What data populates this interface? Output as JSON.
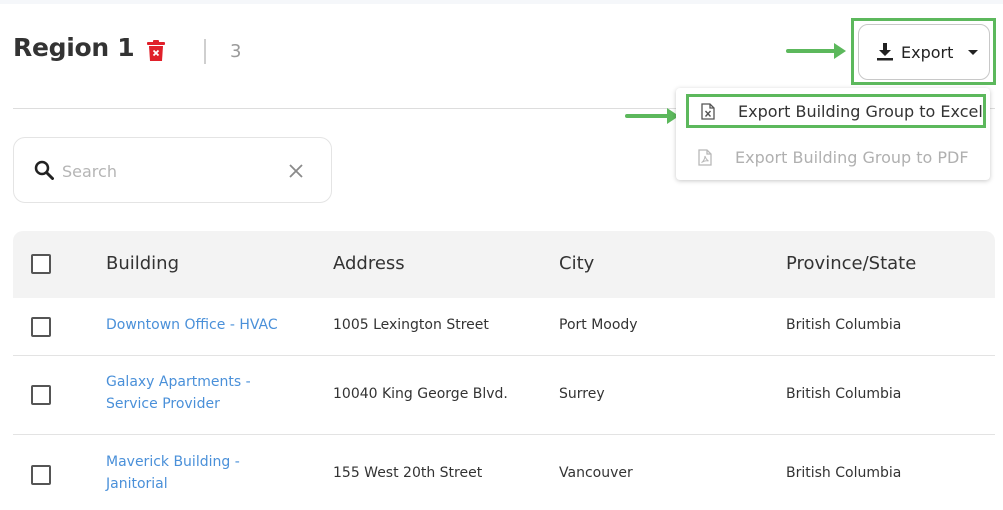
{
  "header": {
    "title": "Region 1",
    "count": "3",
    "export_label": "Export"
  },
  "export_menu": {
    "items": [
      {
        "label": "Export Building Group to Excel",
        "enabled": true
      },
      {
        "label": "Export Building Group to PDF",
        "enabled": false
      }
    ]
  },
  "search": {
    "placeholder": "Search",
    "value": ""
  },
  "table": {
    "columns": [
      "Building",
      "Address",
      "City",
      "Province/State"
    ],
    "rows": [
      {
        "building": "Downtown Office - HVAC",
        "address": "1005 Lexington Street",
        "city": "Port Moody",
        "province": "British Columbia"
      },
      {
        "building": "Galaxy Apartments - Service Provider",
        "address": "10040 King George Blvd.",
        "city": "Surrey",
        "province": "British Columbia"
      },
      {
        "building": "Maverick Building - Janitorial",
        "address": "155 West 20th Street",
        "city": "Vancouver",
        "province": "British Columbia"
      }
    ]
  },
  "colors": {
    "highlight": "#5cb85c",
    "link": "#4a90d9",
    "delete": "#e0202a"
  }
}
